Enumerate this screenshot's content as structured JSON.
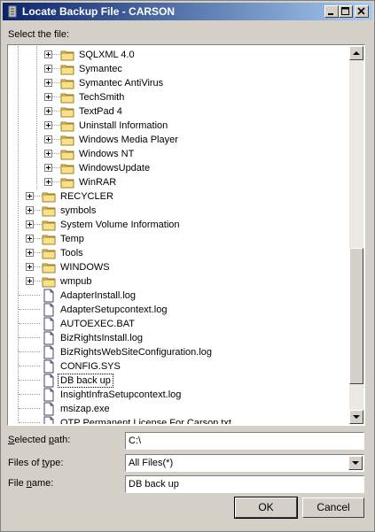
{
  "window": {
    "title": "Locate Backup File - CARSON"
  },
  "labels": {
    "select_file": "Select the file:",
    "selected_path": "Selected path:",
    "files_of_type": "Files of type:",
    "file_name": "File name:"
  },
  "tree": {
    "items": [
      {
        "label": "SQLXML 4.0",
        "type": "folder",
        "level": 2,
        "expandable": true
      },
      {
        "label": "Symantec",
        "type": "folder",
        "level": 2,
        "expandable": true
      },
      {
        "label": "Symantec AntiVirus",
        "type": "folder",
        "level": 2,
        "expandable": true
      },
      {
        "label": "TechSmith",
        "type": "folder",
        "level": 2,
        "expandable": true
      },
      {
        "label": "TextPad 4",
        "type": "folder",
        "level": 2,
        "expandable": true
      },
      {
        "label": "Uninstall Information",
        "type": "folder",
        "level": 2,
        "expandable": true
      },
      {
        "label": "Windows Media Player",
        "type": "folder",
        "level": 2,
        "expandable": true
      },
      {
        "label": "Windows NT",
        "type": "folder",
        "level": 2,
        "expandable": true
      },
      {
        "label": "WindowsUpdate",
        "type": "folder",
        "level": 2,
        "expandable": true
      },
      {
        "label": "WinRAR",
        "type": "folder",
        "level": 2,
        "expandable": true
      },
      {
        "label": "RECYCLER",
        "type": "folder",
        "level": 1,
        "expandable": true
      },
      {
        "label": "symbols",
        "type": "folder",
        "level": 1,
        "expandable": true
      },
      {
        "label": "System Volume Information",
        "type": "folder",
        "level": 1,
        "expandable": true
      },
      {
        "label": "Temp",
        "type": "folder",
        "level": 1,
        "expandable": true
      },
      {
        "label": "Tools",
        "type": "folder",
        "level": 1,
        "expandable": true
      },
      {
        "label": "WINDOWS",
        "type": "folder",
        "level": 1,
        "expandable": true
      },
      {
        "label": "wmpub",
        "type": "folder",
        "level": 1,
        "expandable": true
      },
      {
        "label": "AdapterInstall.log",
        "type": "file",
        "level": 1
      },
      {
        "label": "AdapterSetupcontext.log",
        "type": "file",
        "level": 1
      },
      {
        "label": "AUTOEXEC.BAT",
        "type": "file",
        "level": 1
      },
      {
        "label": "BizRightsInstall.log",
        "type": "file",
        "level": 1
      },
      {
        "label": "BizRightsWebSiteConfiguration.log",
        "type": "file",
        "level": 1
      },
      {
        "label": "CONFIG.SYS",
        "type": "file",
        "level": 1
      },
      {
        "label": "DB back up",
        "type": "file",
        "level": 1,
        "selected": true
      },
      {
        "label": "InsightInfraSetupcontext.log",
        "type": "file",
        "level": 1
      },
      {
        "label": "msizap.exe",
        "type": "file",
        "level": 1
      },
      {
        "label": "QTP Permanent License For Carson.txt",
        "type": "file",
        "level": 1
      }
    ]
  },
  "selected_path": {
    "value": "C:\\"
  },
  "files_of_type": {
    "value": "All Files(*)"
  },
  "file_name": {
    "value": "DB back up"
  },
  "buttons": {
    "ok": "OK",
    "cancel": "Cancel"
  },
  "colors": {
    "title_start": "#0a246a",
    "title_end": "#a6caf0",
    "folder": "#f5d46b",
    "dialog": "#d4d0c8"
  }
}
